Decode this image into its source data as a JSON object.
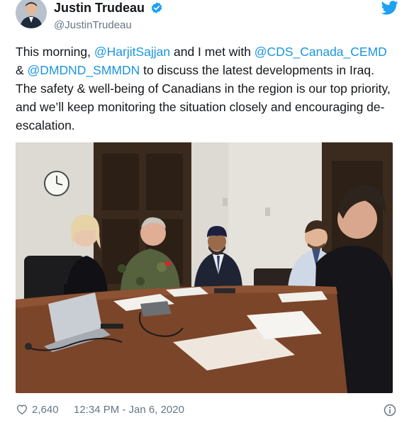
{
  "author": {
    "display_name": "Justin Trudeau",
    "handle": "@JustinTrudeau",
    "verified": true
  },
  "tweet": {
    "segments": [
      {
        "text": "This morning, ",
        "mention": false
      },
      {
        "text": "@HarjitSajjan",
        "mention": true
      },
      {
        "text": " and I met with ",
        "mention": false
      },
      {
        "text": "@CDS_Canada_CEMD",
        "mention": true
      },
      {
        "text": " & ",
        "mention": false
      },
      {
        "text": "@DMDND_SMMDN",
        "mention": true
      },
      {
        "text": " to discuss the latest developments in Iraq. The safety & well-being of Canadians in the region is our top priority, and we’ll keep monitoring the situation closely and encouraging de-escalation.",
        "mention": false
      }
    ]
  },
  "footer": {
    "like_count": "2,640",
    "timestamp": "12:34 PM - Jan 6, 2020"
  },
  "colors": {
    "link": "#1b95e0",
    "verified_badge": "#1da1f2",
    "twitter_blue": "#1da1f2",
    "secondary_text": "#657786"
  },
  "icons": {
    "verified": "verified-badge-icon",
    "twitter": "twitter-bird-icon",
    "like": "heart-icon",
    "info": "info-circle-icon"
  }
}
